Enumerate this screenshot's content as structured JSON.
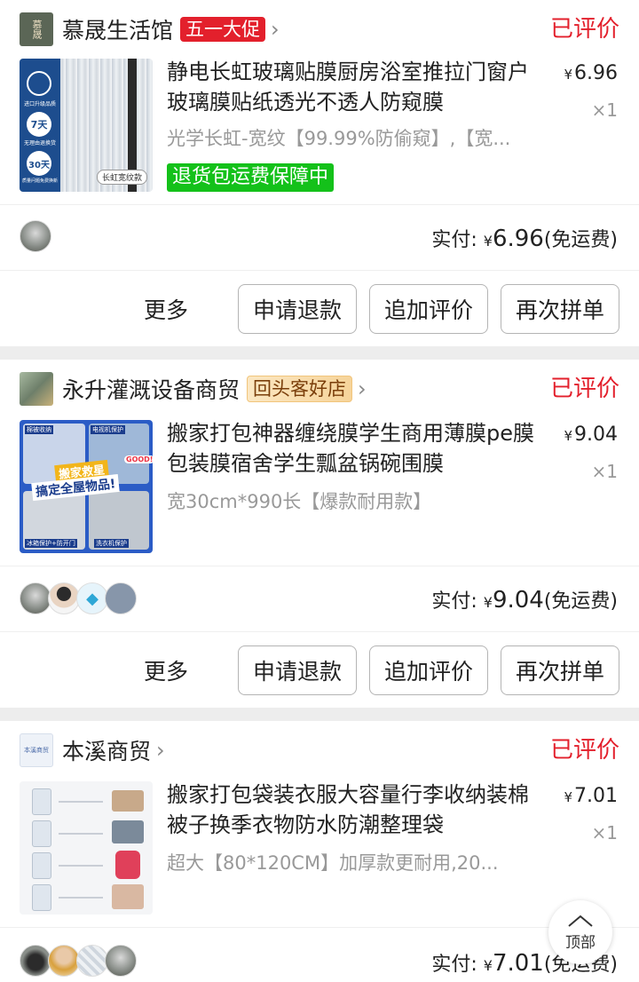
{
  "orders": [
    {
      "shop_name": "慕晟生活馆",
      "shop_logo_text": "慕晟",
      "badge": "五一大促",
      "status": "已评价",
      "title": "静电长虹玻璃贴膜厨房浴室推拉门窗户玻璃膜贴纸透光不透人防窥膜",
      "spec": "光学长虹-宽纹【99.99%防偷窥】,【宽...",
      "guarantee": "退货包运费保障中",
      "price_symbol": "¥",
      "price": "6.96",
      "qty": "×1",
      "paid_label": "实付:",
      "paid_amount": "6.96",
      "shipping": "(免运费)",
      "thumb_caption": "长虹宽纹款",
      "thumb_badges": [
        "进口升级品质",
        "7天",
        "无理由退换货",
        "30天",
        "质量问题免费换新"
      ],
      "avatars": [
        "avatar-1"
      ]
    },
    {
      "shop_name": "永升灌溉设备商贸",
      "badge": "回头客好店",
      "status": "已评价",
      "title": "搬家打包神器缠绕膜学生商用薄膜pe膜包装膜宿舍学生瓢盆锅碗围膜",
      "spec": "宽30cm*990长【爆款耐用款】",
      "price_symbol": "¥",
      "price": "9.04",
      "qty": "×1",
      "paid_label": "实付:",
      "paid_amount": "9.04",
      "shipping": "(免运费)",
      "thumb_texts": [
        "棉被收纳",
        "电视机保护",
        "搬家救星",
        "搞定全屋物品!",
        "冰箱保护+防开门",
        "洗衣机保护",
        "GOOD!"
      ],
      "avatars": [
        "avatar-1",
        "avatar-2",
        "avatar-3",
        "avatar-4"
      ]
    },
    {
      "shop_name": "本溪商贸",
      "shop_logo_text": "本溪商贸",
      "status": "已评价",
      "title": "搬家打包袋装衣服大容量行李收纳装棉被子换季衣物防水防潮整理袋",
      "spec": "超大【80*120CM】加厚款更耐用,20...",
      "price_symbol": "¥",
      "price": "7.01",
      "qty": "×1",
      "paid_label": "实付:",
      "paid_amount": "7.01",
      "shipping": "(免运费)",
      "avatars": [
        "avatar-1",
        "avatar-2",
        "avatar-3",
        "avatar-4"
      ]
    }
  ],
  "actions": {
    "more": "更多",
    "refund": "申请退款",
    "add_review": "追加评价",
    "reorder": "再次拼单"
  },
  "top_button": {
    "label": "顶部",
    "icon": "chevron-up-icon"
  },
  "colors": {
    "accent_red": "#e3202c",
    "guarantee_green": "#14c11a"
  }
}
